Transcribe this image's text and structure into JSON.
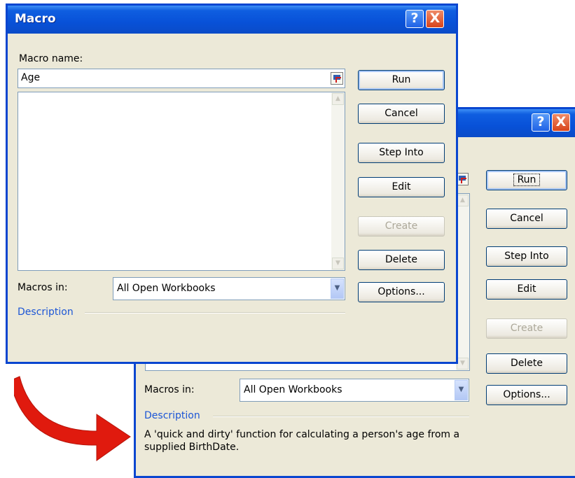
{
  "back_dialog": {
    "help_glyph": "?",
    "close_glyph": "X",
    "macro_name_value": "",
    "macros_in_label": "Macros in:",
    "macros_in_value": "All Open Workbooks",
    "description_label": "Description",
    "description_text": "A 'quick and dirty' function for calculating a person's age from a supplied BirthDate.",
    "buttons": {
      "run": "Run",
      "cancel": "Cancel",
      "step_into": "Step Into",
      "edit": "Edit",
      "create": "Create",
      "delete": "Delete",
      "options": "Options..."
    }
  },
  "front_dialog": {
    "title": "Macro",
    "help_glyph": "?",
    "close_glyph": "X",
    "macro_name_label": "Macro name:",
    "macro_name_value": "Age",
    "macro_list": [],
    "macros_in_label": "Macros in:",
    "macros_in_value": "All Open Workbooks",
    "description_label": "Description",
    "description_text": "",
    "buttons": {
      "run": "Run",
      "cancel": "Cancel",
      "step_into": "Step Into",
      "edit": "Edit",
      "create": "Create",
      "delete": "Delete",
      "options": "Options..."
    }
  },
  "colors": {
    "title_bar": "#0a4bc8",
    "dialog_bg": "#ece9d8",
    "description_label": "#1c56d6",
    "arrow": "#e01a0e"
  }
}
